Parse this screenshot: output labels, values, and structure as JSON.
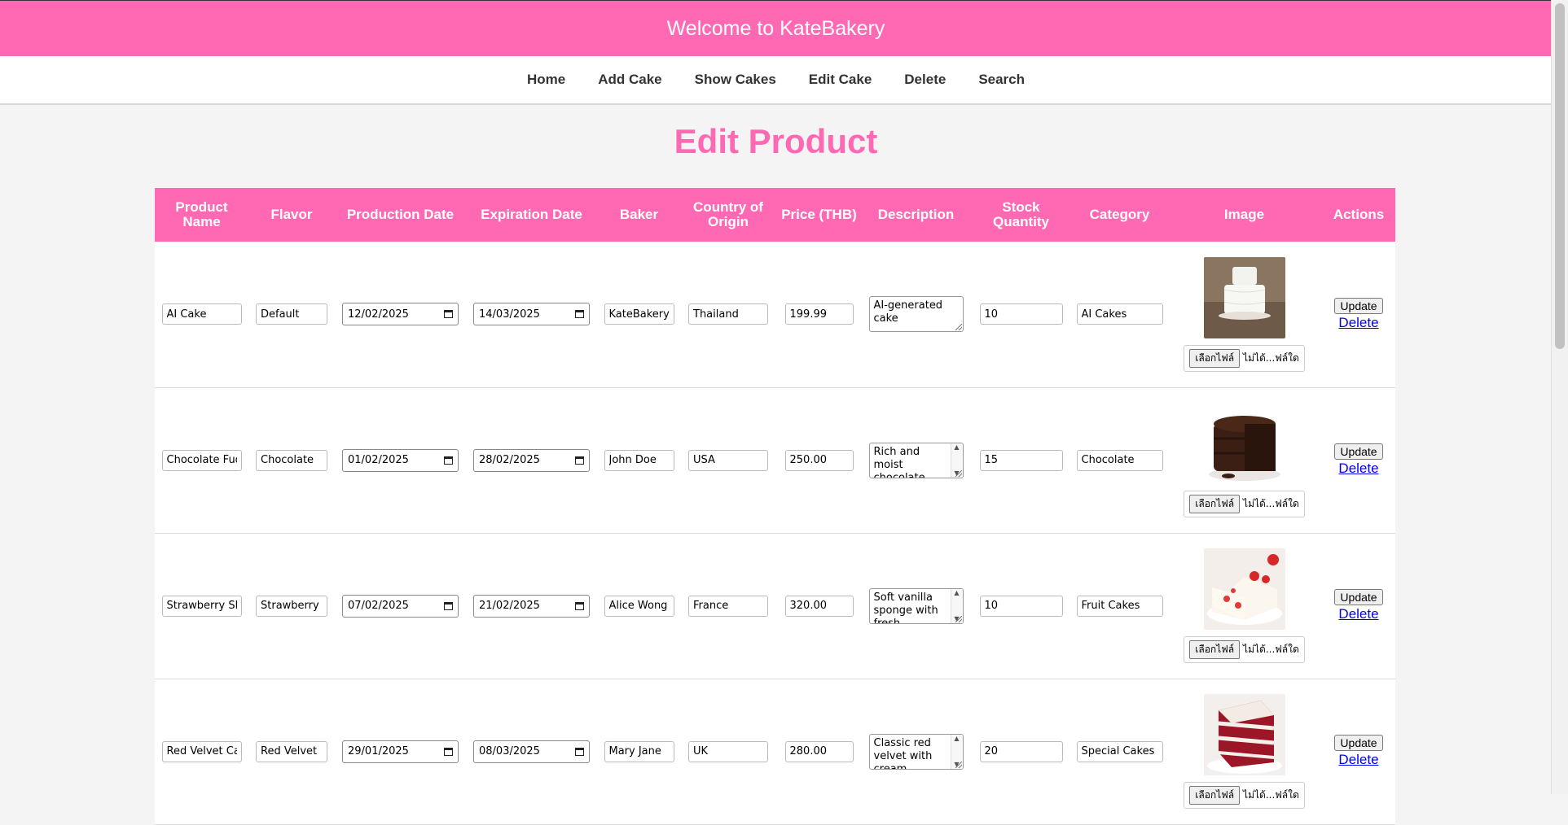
{
  "header": {
    "title": "Welcome to KateBakery",
    "bg_color": "#ff69b4"
  },
  "nav": {
    "items": [
      "Home",
      "Add Cake",
      "Show Cakes",
      "Edit Cake",
      "Delete",
      "Search"
    ]
  },
  "page_title": "Edit Product",
  "table": {
    "columns": [
      "Product Name",
      "Flavor",
      "Production Date",
      "Expiration Date",
      "Baker",
      "Country of Origin",
      "Price (THB)",
      "Description",
      "Stock Quantity",
      "Category",
      "Image",
      "Actions"
    ],
    "file_button_label": "เลือกไฟล์",
    "file_status": "ไม่ได้...ฟล์ใด",
    "update_label": "Update",
    "delete_label": "Delete",
    "rows": [
      {
        "name": "AI Cake",
        "flavor": "Default",
        "production_date": "12/02/2025",
        "expiration_date": "14/03/2025",
        "baker": "KateBakery",
        "country": "Thailand",
        "price": "199.99",
        "description": "AI-generated cake",
        "stock": "10",
        "category": "AI Cakes",
        "image_icon": "white-tiered-cake-image"
      },
      {
        "name": "Chocolate Fud",
        "flavor": "Chocolate",
        "production_date": "01/02/2025",
        "expiration_date": "28/02/2025",
        "baker": "John Doe",
        "country": "USA",
        "price": "250.00",
        "description": "Rich and moist chocolate cake with fud",
        "stock": "15",
        "category": "Chocolate",
        "image_icon": "chocolate-cake-image"
      },
      {
        "name": "Strawberry Sh",
        "flavor": "Strawberry",
        "production_date": "07/02/2025",
        "expiration_date": "21/02/2025",
        "baker": "Alice Wong",
        "country": "France",
        "price": "320.00",
        "description": "Soft vanilla sponge with fresh",
        "stock": "10",
        "category": "Fruit Cakes",
        "image_icon": "strawberry-shortcake-image"
      },
      {
        "name": "Red Velvet Ca",
        "flavor": "Red Velvet",
        "production_date": "29/01/2025",
        "expiration_date": "08/03/2025",
        "baker": "Mary Jane",
        "country": "UK",
        "price": "280.00",
        "description": "Classic red velvet with cream",
        "stock": "20",
        "category": "Special Cakes",
        "image_icon": "red-velvet-cake-image"
      }
    ]
  }
}
